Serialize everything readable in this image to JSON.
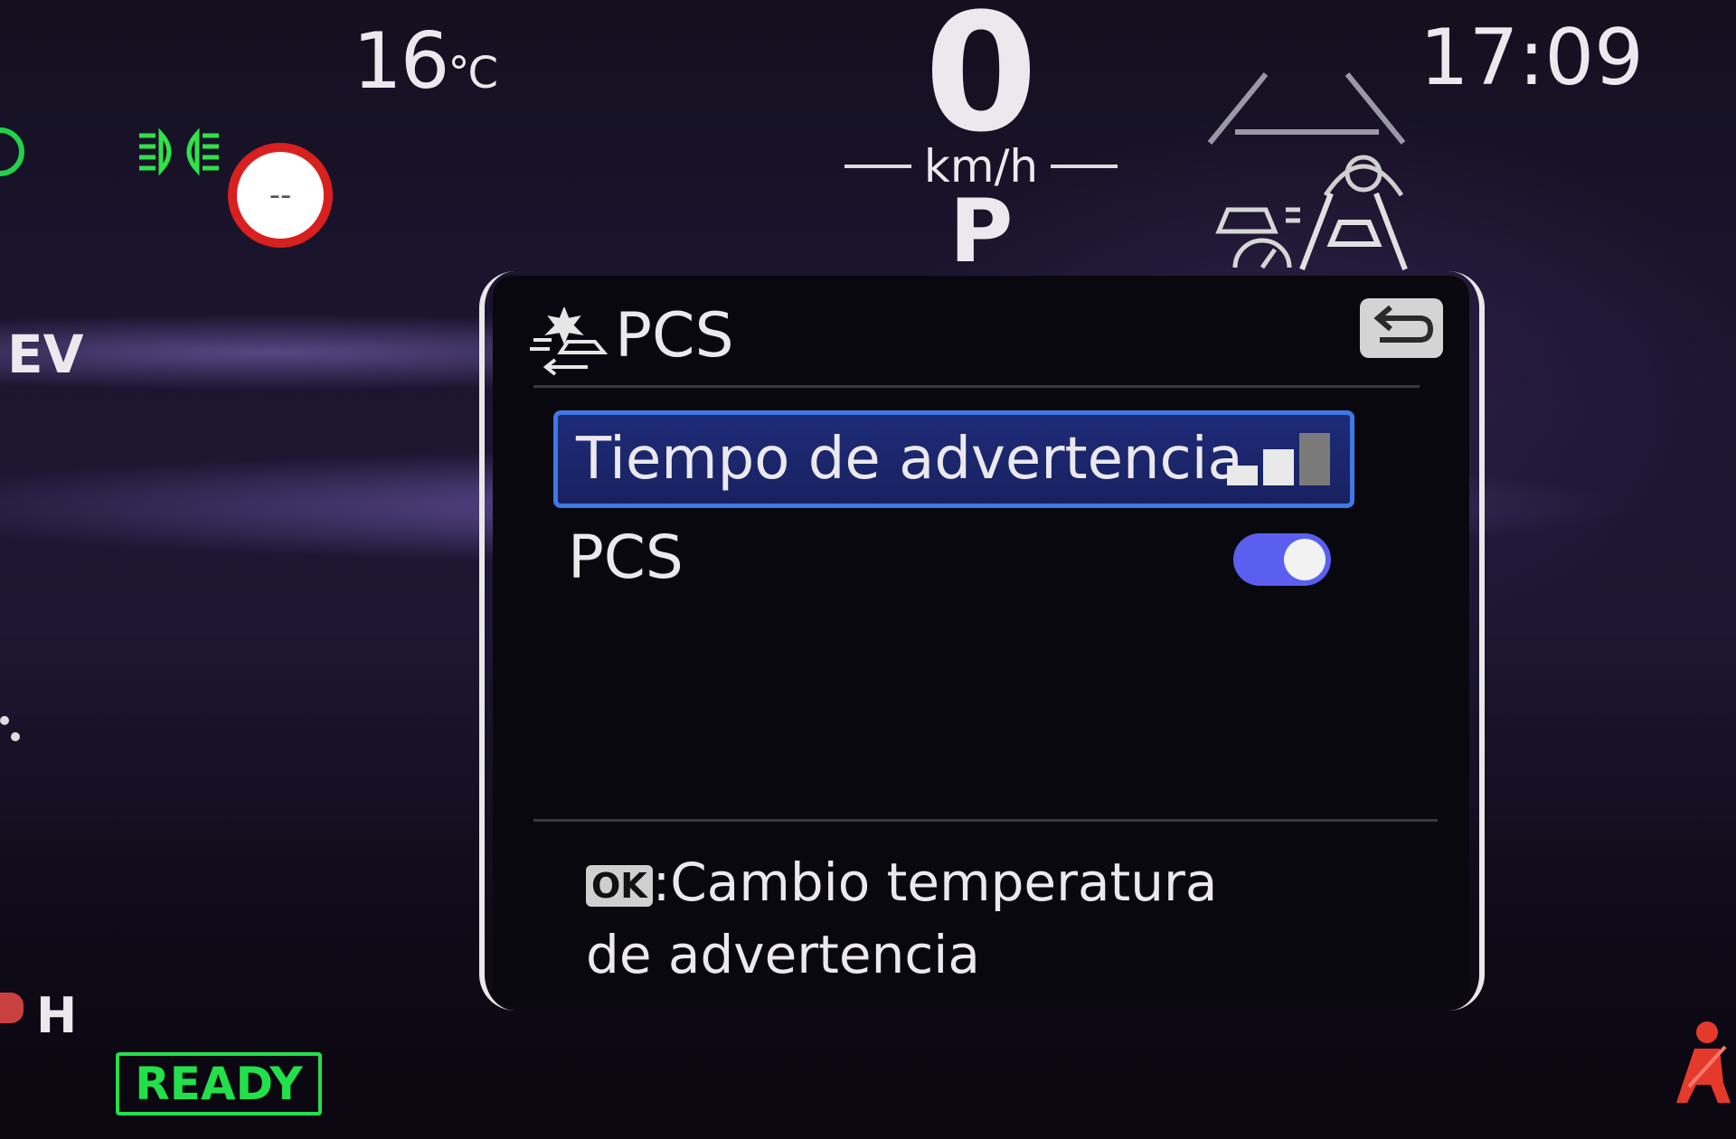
{
  "cluster": {
    "temperature_value": "16",
    "temperature_unit": "°C",
    "clock": "17:09",
    "speed_value": "0",
    "speed_unit": "km/h",
    "gear": "P",
    "mode_label": "EV",
    "gauge_label": "H",
    "ready_label": "READY",
    "speed_limit_sign_text": "--"
  },
  "pcs_panel": {
    "title": "PCS",
    "title_icon": "pre-collision-icon",
    "back_icon": "return-icon",
    "items": [
      {
        "label": "Tiempo de advertencia",
        "control": "level-bars",
        "level": 2,
        "level_max": 3,
        "selected": true
      },
      {
        "label": "PCS",
        "control": "toggle",
        "value": true,
        "selected": false
      }
    ],
    "hint_key": "OK",
    "hint_line1": ":Cambio temperatura",
    "hint_line2": "de advertencia"
  },
  "colors": {
    "ready_green": "#22e04a",
    "selection_border": "#3f78e6",
    "toggle_on": "#5b5ff0",
    "seatbelt_warning": "#e53a2b",
    "speed_sign_red": "#d8201f"
  }
}
